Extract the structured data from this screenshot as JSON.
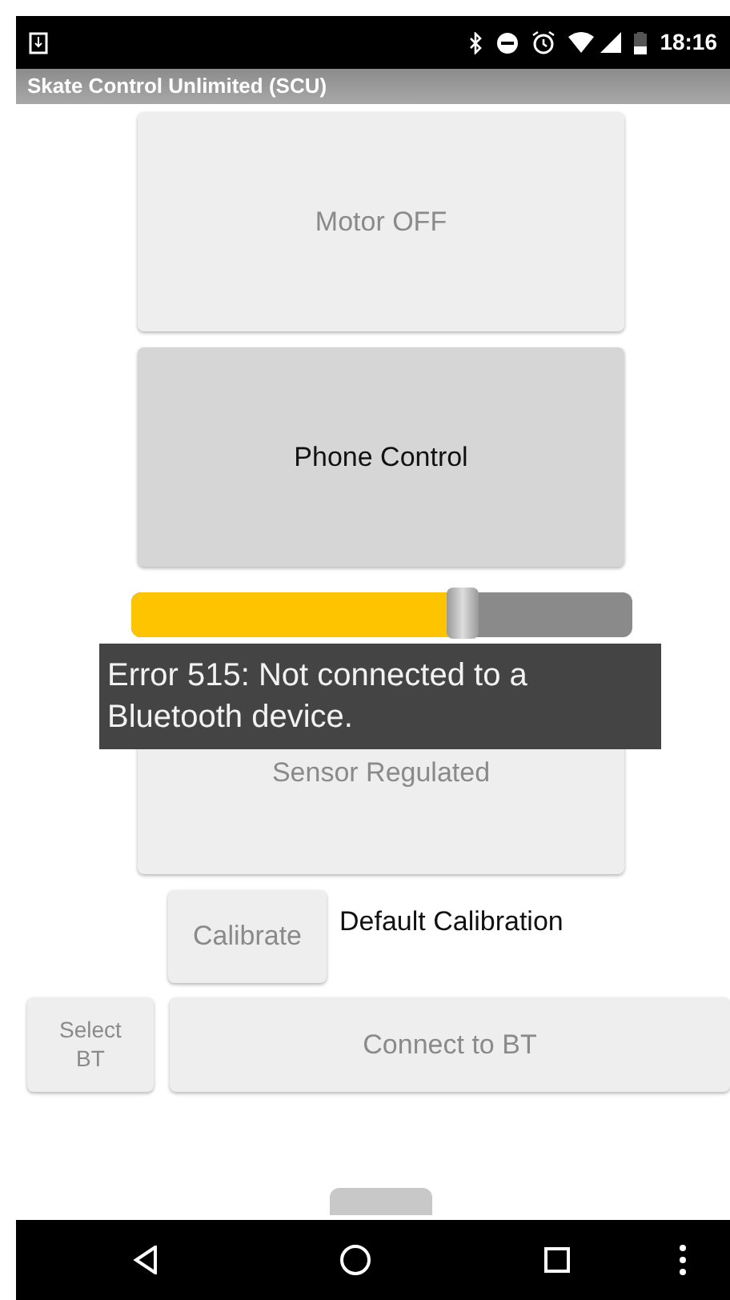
{
  "status_bar": {
    "time": "18:16"
  },
  "app_bar": {
    "title": "Skate Control Unlimited (SCU)"
  },
  "mode_buttons": [
    {
      "label": "Motor OFF",
      "disabled": true
    },
    {
      "label": "Phone Control",
      "disabled": false
    }
  ],
  "speed_slider": {
    "level": 0.66
  },
  "sensor_button": {
    "label": "Sensor Regulated",
    "disabled": true
  },
  "toast": {
    "text": "Error 515: Not connected to a Bluetooth device."
  },
  "calibrate_button": {
    "label": "Calibrate",
    "disabled": true
  },
  "calibration_status": "Default Calibration",
  "select_bt_button": {
    "label": "Select BT",
    "disabled": true
  },
  "connect_button": {
    "label": "Connect to BT",
    "disabled": true
  }
}
